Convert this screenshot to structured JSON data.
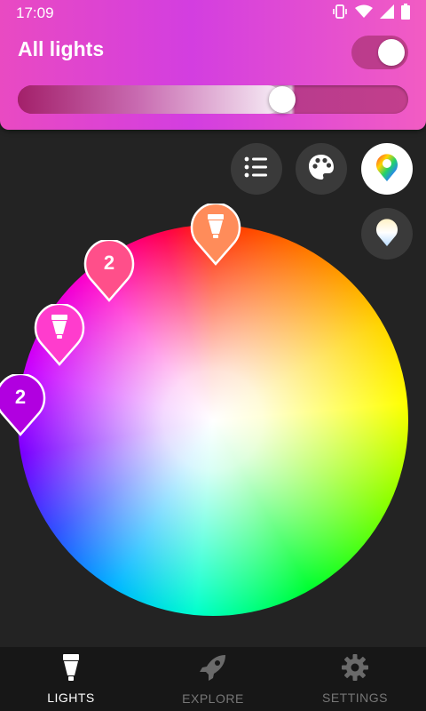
{
  "status": {
    "time": "17:09",
    "icons": [
      "vibrate-icon",
      "wifi-icon",
      "signal-icon",
      "battery-icon"
    ]
  },
  "header": {
    "title": "All lights",
    "toggle_on": true,
    "brightness_percent": 69,
    "background_colors": [
      "#e94ac2",
      "#d33ee0",
      "#f25cc3"
    ]
  },
  "mode_buttons": [
    {
      "name": "list-view-button",
      "icon": "list-icon",
      "active": false
    },
    {
      "name": "scenes-palette-button",
      "icon": "palette-icon",
      "active": false
    },
    {
      "name": "color-picker-button",
      "icon": "color-drop-icon",
      "active": true
    },
    {
      "name": "white-temperature-button",
      "icon": "white-drop-icon",
      "active": false
    }
  ],
  "color_wheel": {
    "pins": [
      {
        "name": "light-pin-bulb",
        "label": "",
        "icon": "bulb-icon",
        "color": "#ff8c5a"
      },
      {
        "name": "light-pin-group-2-pink",
        "label": "2",
        "icon": "",
        "color": "#ff4f8a"
      },
      {
        "name": "light-pin-bulb-pink",
        "label": "",
        "icon": "bulb-icon",
        "color": "#ff3ccd"
      },
      {
        "name": "light-pin-group-2-purple",
        "label": "2",
        "icon": "",
        "color": "#b100e0"
      }
    ]
  },
  "bottom_nav": [
    {
      "label": "LIGHTS",
      "icon": "bulb-icon",
      "active": true
    },
    {
      "label": "EXPLORE",
      "icon": "rocket-icon",
      "active": false
    },
    {
      "label": "SETTINGS",
      "icon": "gear-icon",
      "active": false
    }
  ]
}
